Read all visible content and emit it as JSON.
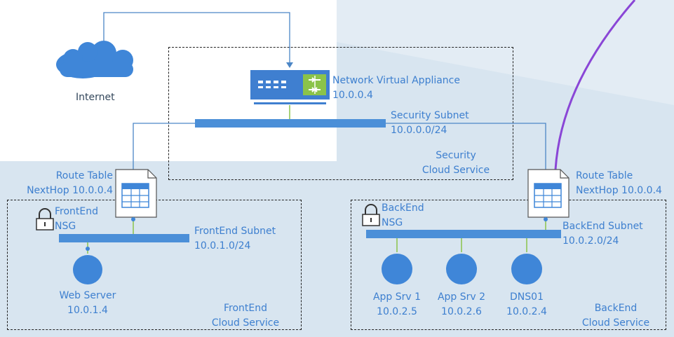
{
  "colors": {
    "background_left": "#dde8f1",
    "background_right": "#cfe0ee",
    "label_blue": "#3d7fcf",
    "subnet_bar": "#4b8fd8",
    "line": "#4c86c6",
    "arc": "#8a46d6"
  },
  "internet": {
    "label": "Internet",
    "icon": "cloud-icon"
  },
  "appliance": {
    "name": "Network Virtual Appliance",
    "ip": "10.0.0.4",
    "icon": "network-appliance-icon"
  },
  "security": {
    "subnet_name": "Security Subnet",
    "subnet_cidr": "10.0.0.0/24",
    "service_line1": "Security",
    "service_line2": "Cloud Service"
  },
  "frontend": {
    "route_table_line1": "Route Table",
    "route_table_line2": "NextHop 10.0.0.4",
    "nsg_line1": "FrontEnd",
    "nsg_line2": "NSG",
    "subnet_name": "FrontEnd Subnet",
    "subnet_cidr": "10.0.1.0/24",
    "servers": [
      {
        "name": "Web Server",
        "ip": "10.0.1.4"
      }
    ],
    "service_line1": "FrontEnd",
    "service_line2": "Cloud Service"
  },
  "backend": {
    "route_table_line1": "Route Table",
    "route_table_line2": "NextHop 10.0.0.4",
    "nsg_line1": "BackEnd",
    "nsg_line2": "NSG",
    "subnet_name": "BackEnd Subnet",
    "subnet_cidr": "10.0.2.0/24",
    "servers": [
      {
        "name": "App Srv 1",
        "ip": "10.0.2.5"
      },
      {
        "name": "App Srv 2",
        "ip": "10.0.2.6"
      },
      {
        "name": "DNS01",
        "ip": "10.0.2.4"
      }
    ],
    "service_line1": "BackEnd",
    "service_line2": "Cloud Service"
  }
}
